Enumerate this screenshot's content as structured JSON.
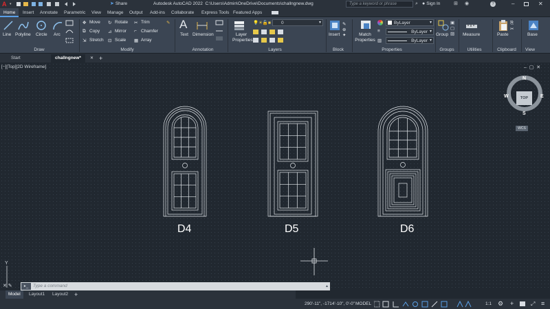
{
  "titlebar": {
    "app_title": "Autodesk AutoCAD 2022",
    "file_path": "C:\\Users\\Admin\\OneDrive\\Documents\\challngnew.dwg",
    "share_label": "Share",
    "search_placeholder": "Type a keyword or phrase",
    "sign_in_label": "Sign In"
  },
  "menu_tabs": [
    "Home",
    "Insert",
    "Annotate",
    "Parametric",
    "View",
    "Manage",
    "Output",
    "Add-ins",
    "Collaborate",
    "Express Tools",
    "Featured Apps"
  ],
  "ribbon": {
    "draw": {
      "label": "Draw",
      "line": "Line",
      "polyline": "Polyline",
      "circle": "Circle",
      "arc": "Arc"
    },
    "modify": {
      "label": "Modify",
      "move": "Move",
      "copy": "Copy",
      "stretch": "Stretch",
      "rotate": "Rotate",
      "mirror": "Mirror",
      "scale": "Scale",
      "trim": "Trim",
      "chamfer": "Chamfer",
      "array": "Array"
    },
    "annotation": {
      "label": "Annotation",
      "text": "Text",
      "dimension": "Dimension"
    },
    "layers": {
      "label": "Layers",
      "layer_properties": "Layer Properties",
      "current_layer": "0"
    },
    "block": {
      "label": "Block",
      "insert": "Insert"
    },
    "properties": {
      "label": "Properties",
      "match_properties": "Match Properties",
      "color": "ByLayer",
      "linetype": "ByLayer",
      "lineweight": "ByLayer"
    },
    "groups": {
      "label": "Groups",
      "group": "Group"
    },
    "utilities": {
      "label": "Utilities",
      "measure": "Measure"
    },
    "clipboard": {
      "label": "Clipboard",
      "paste": "Paste"
    },
    "view": {
      "label": "View",
      "base": "Base"
    }
  },
  "doc_tabs": {
    "start": "Start",
    "active": "challngnew*"
  },
  "viewport": {
    "label": "[−][Top][2D Wireframe]",
    "doors": [
      {
        "label": "D4"
      },
      {
        "label": "D5"
      },
      {
        "label": "D6"
      }
    ],
    "viewcube": {
      "north": "N",
      "south": "S",
      "east": "E",
      "west": "W",
      "top": "TOP",
      "wcs": "WCS"
    },
    "ucs_y": "Y"
  },
  "command_line": {
    "placeholder": "Type a command"
  },
  "layout_tabs": [
    "Model",
    "Layout1",
    "Layout2"
  ],
  "statusbar": {
    "coordinates": "290'-11\", -1714'-10\", 0'-0\"",
    "space": "MODEL",
    "scale": "1:1"
  },
  "colors": {
    "accent": "#5aa0e8",
    "autocad_red": "#e0292c",
    "background": "#212830"
  }
}
